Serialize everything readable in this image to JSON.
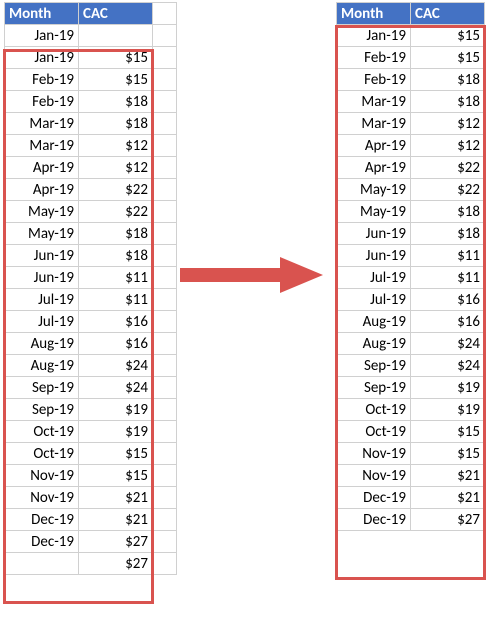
{
  "headers": {
    "month": "Month",
    "cac": "CAC"
  },
  "left_rows": [
    {
      "month": "Jan-19",
      "cac": ""
    },
    {
      "month": "Jan-19",
      "cac": "$15"
    },
    {
      "month": "Feb-19",
      "cac": "$15"
    },
    {
      "month": "Feb-19",
      "cac": "$18"
    },
    {
      "month": "Mar-19",
      "cac": "$18"
    },
    {
      "month": "Mar-19",
      "cac": "$12"
    },
    {
      "month": "Apr-19",
      "cac": "$12"
    },
    {
      "month": "Apr-19",
      "cac": "$22"
    },
    {
      "month": "May-19",
      "cac": "$22"
    },
    {
      "month": "May-19",
      "cac": "$18"
    },
    {
      "month": "Jun-19",
      "cac": "$18"
    },
    {
      "month": "Jun-19",
      "cac": "$11"
    },
    {
      "month": "Jul-19",
      "cac": "$11"
    },
    {
      "month": "Jul-19",
      "cac": "$16"
    },
    {
      "month": "Aug-19",
      "cac": "$16"
    },
    {
      "month": "Aug-19",
      "cac": "$24"
    },
    {
      "month": "Sep-19",
      "cac": "$24"
    },
    {
      "month": "Sep-19",
      "cac": "$19"
    },
    {
      "month": "Oct-19",
      "cac": "$19"
    },
    {
      "month": "Oct-19",
      "cac": "$15"
    },
    {
      "month": "Nov-19",
      "cac": "$15"
    },
    {
      "month": "Nov-19",
      "cac": "$21"
    },
    {
      "month": "Dec-19",
      "cac": "$21"
    },
    {
      "month": "Dec-19",
      "cac": "$27"
    },
    {
      "month": "",
      "cac": "$27"
    }
  ],
  "right_rows": [
    {
      "month": "Jan-19",
      "cac": "$15"
    },
    {
      "month": "Feb-19",
      "cac": "$15"
    },
    {
      "month": "Feb-19",
      "cac": "$18"
    },
    {
      "month": "Mar-19",
      "cac": "$18"
    },
    {
      "month": "Mar-19",
      "cac": "$12"
    },
    {
      "month": "Apr-19",
      "cac": "$12"
    },
    {
      "month": "Apr-19",
      "cac": "$22"
    },
    {
      "month": "May-19",
      "cac": "$22"
    },
    {
      "month": "May-19",
      "cac": "$18"
    },
    {
      "month": "Jun-19",
      "cac": "$18"
    },
    {
      "month": "Jun-19",
      "cac": "$11"
    },
    {
      "month": "Jul-19",
      "cac": "$11"
    },
    {
      "month": "Jul-19",
      "cac": "$16"
    },
    {
      "month": "Aug-19",
      "cac": "$16"
    },
    {
      "month": "Aug-19",
      "cac": "$24"
    },
    {
      "month": "Sep-19",
      "cac": "$24"
    },
    {
      "month": "Sep-19",
      "cac": "$19"
    },
    {
      "month": "Oct-19",
      "cac": "$19"
    },
    {
      "month": "Oct-19",
      "cac": "$15"
    },
    {
      "month": "Nov-19",
      "cac": "$15"
    },
    {
      "month": "Nov-19",
      "cac": "$21"
    },
    {
      "month": "Dec-19",
      "cac": "$21"
    },
    {
      "month": "Dec-19",
      "cac": "$27"
    }
  ],
  "colors": {
    "header_bg": "#4472C4",
    "outline": "#d9534f"
  }
}
